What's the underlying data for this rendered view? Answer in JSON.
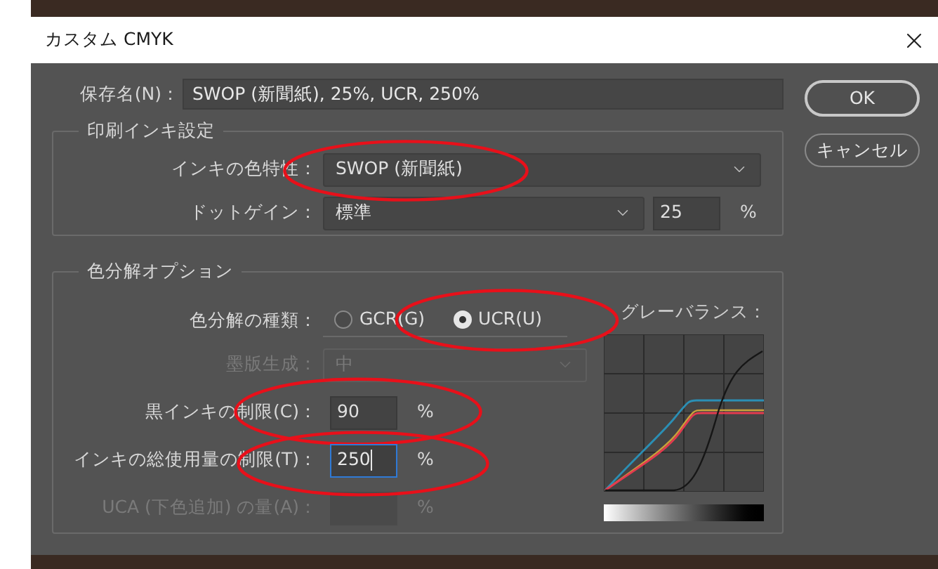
{
  "window": {
    "title": "カスタム CMYK"
  },
  "save_name": {
    "label": "保存名(N)：",
    "value": "SWOP (新聞紙), 25%, UCR, 250%"
  },
  "buttons": [
    {
      "label": "OK",
      "default": true
    },
    {
      "label": "キャンセル",
      "default": false
    }
  ],
  "ink_options": {
    "title": "印刷インキ設定",
    "ink_colors": {
      "label": "インキの色特性：",
      "value": "SWOP (新聞紙)",
      "highlighted": true
    },
    "dot_gain": {
      "label": "ドットゲイン：",
      "value": "標準",
      "amount": "25",
      "unit": "%"
    }
  },
  "separation_options": {
    "title": "色分解オプション",
    "type": {
      "label": "色分解の種類：",
      "highlighted": true,
      "options": [
        {
          "label": "GCR(G)",
          "selected": false
        },
        {
          "label": "UCR(U)",
          "selected": true
        }
      ]
    },
    "black_generation": {
      "label": "墨版生成：",
      "value": "中",
      "disabled": true
    },
    "black_ink_limit": {
      "label": "黒インキの制限(C)：",
      "value": "90",
      "unit": "%",
      "highlighted": true
    },
    "total_ink_limit": {
      "label": "インキの総使用量の制限(T)：",
      "value": "250",
      "unit": "%",
      "highlighted": true,
      "focused": true
    },
    "uca_amount": {
      "label": "UCA (下色追加) の量(A)：",
      "unit": "%",
      "disabled": true
    },
    "gray_balance": {
      "label": "グレーバランス："
    }
  }
}
